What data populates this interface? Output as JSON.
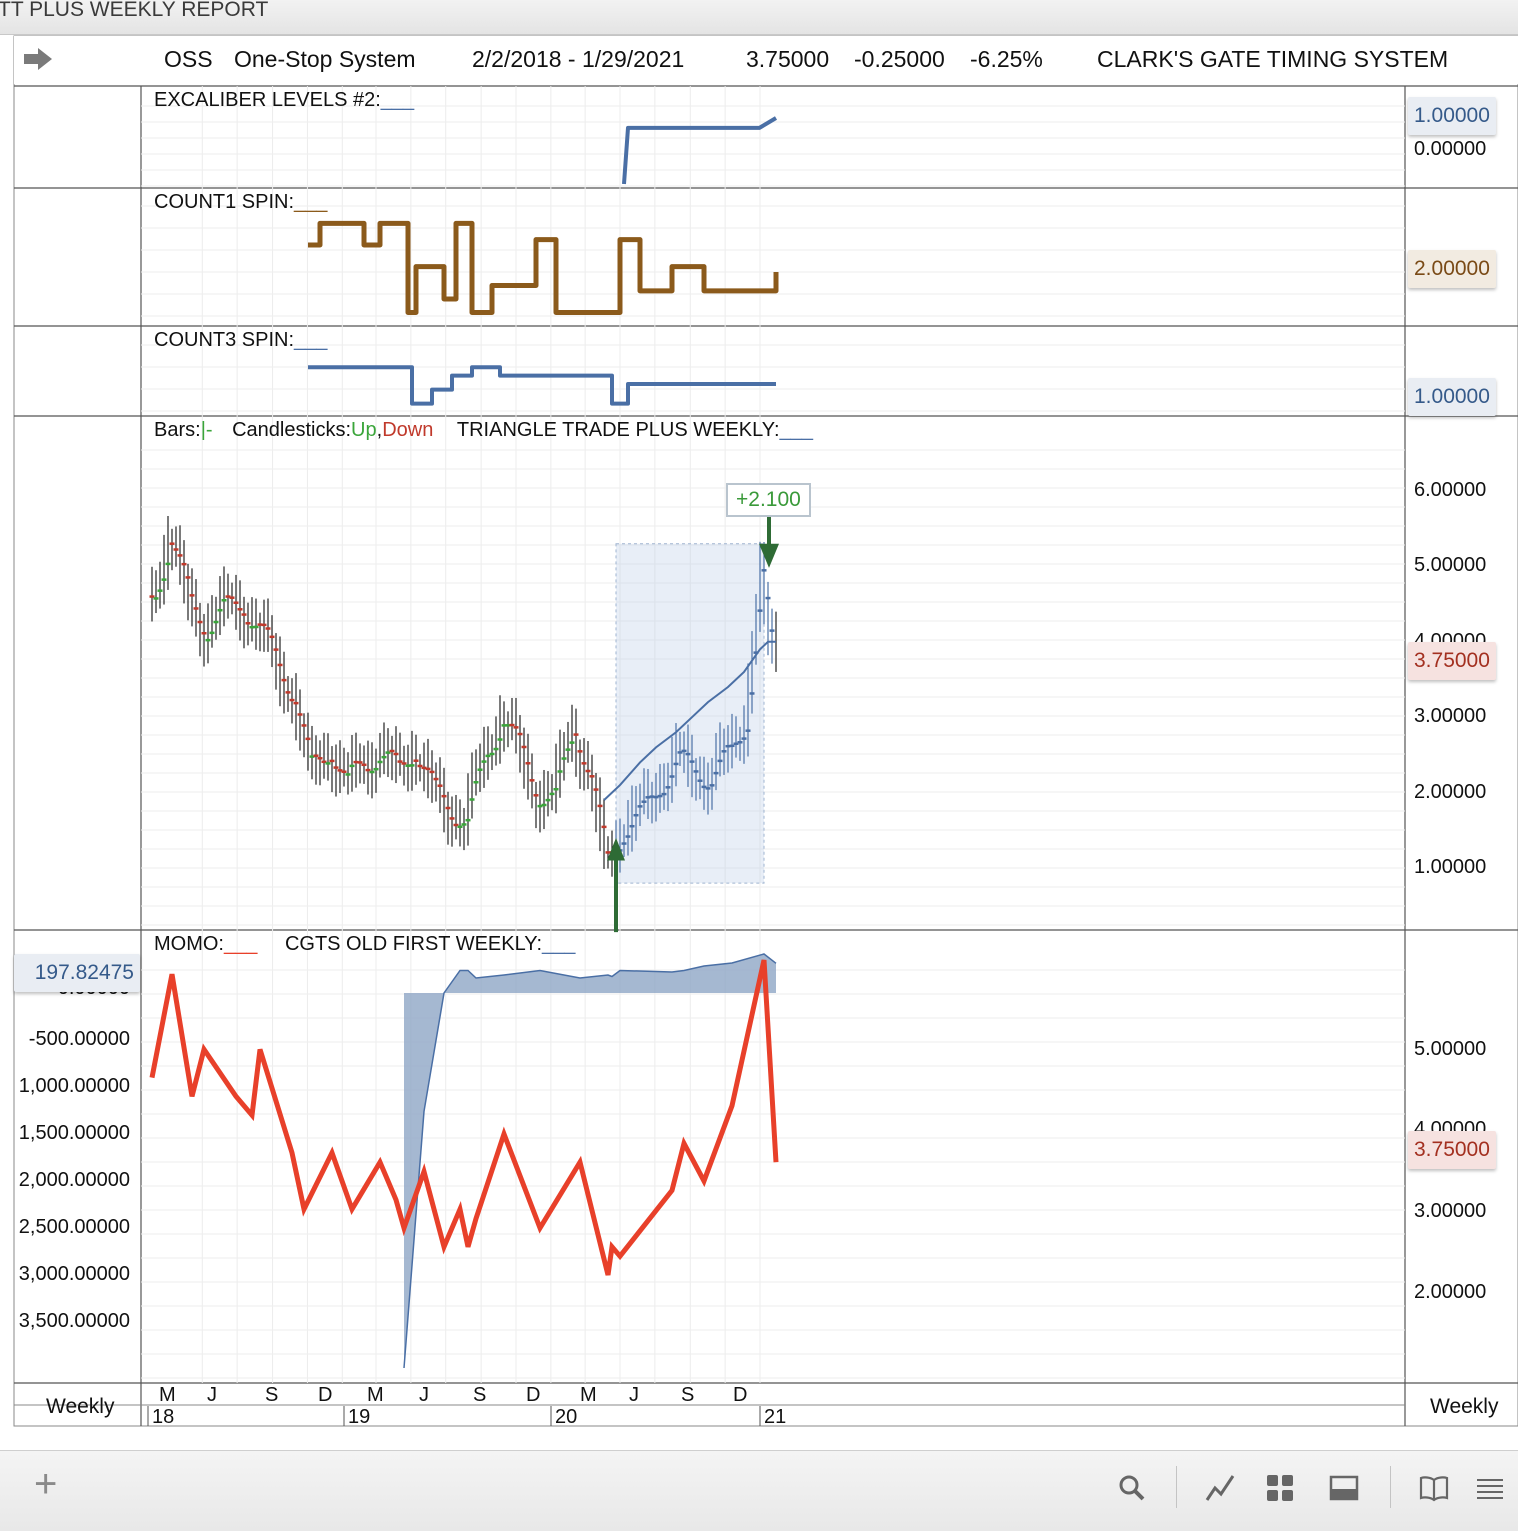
{
  "window": {
    "title": "TT PLUS WEEKLY REPORT"
  },
  "header": {
    "symbol": "OSS",
    "company": "One-Stop System",
    "date_range": "2/2/2018 - 1/29/2021",
    "last": "3.75000",
    "change": "-0.25000",
    "change_pct": "-6.25%",
    "system_name": "CLARK'S GATE TIMING SYSTEM"
  },
  "panes": {
    "excaliber": {
      "label": "EXCALIBER LEVELS #2:",
      "legend_blank": "___",
      "value_badge": "1.00000",
      "tick": "0.00000",
      "color": "#4a6fa5"
    },
    "count1": {
      "label": "COUNT1 SPIN:",
      "legend_blank": "___",
      "value_badge": "2.00000",
      "color": "#8b5a1b"
    },
    "count3": {
      "label": "COUNT3 SPIN:",
      "legend_blank": "___",
      "value_badge": "1.00000",
      "color": "#4a6fa5"
    },
    "price": {
      "bars_label": "Bars:",
      "bars_glyph": "|-",
      "candles_label": "Candlesticks:",
      "up": "Up",
      "comma": ",",
      "down": "Down",
      "indicator": "TRIANGLE TRADE PLUS WEEKLY:",
      "legend_blank": "___",
      "ticks": [
        "6.00000",
        "5.00000",
        "4.00000",
        "3.00000",
        "2.00000",
        "1.00000"
      ],
      "last_badge": "3.75000",
      "trade_gain": "+2.100"
    },
    "momo": {
      "label": "MOMO:",
      "legend_blank": "___",
      "indicator": "CGTS OLD FIRST WEEKLY:",
      "legend_blank2": "___",
      "left_badge": "197.82475",
      "left_hidden_tick": "0.00000",
      "left_ticks": [
        "-500.00000",
        "1,000.00000",
        "1,500.00000",
        "2,000.00000",
        "2,500.00000",
        "3,000.00000",
        "3,500.00000"
      ],
      "right_ticks": [
        "5.00000",
        "4.00000",
        "3.00000",
        "2.00000"
      ],
      "right_badge": "3.75000"
    }
  },
  "x_axis": {
    "months": [
      "M",
      "J",
      "S",
      "D",
      "M",
      "J",
      "S",
      "D",
      "M",
      "J",
      "S",
      "D"
    ],
    "years": [
      "18",
      "19",
      "20",
      "21"
    ],
    "period_left": "Weekly",
    "period_right": "Weekly"
  },
  "toolbar": {
    "add": "+",
    "icons": [
      "search-icon",
      "chart-line-icon",
      "grid-icon",
      "panel-icon",
      "book-icon",
      "list-icon"
    ]
  },
  "colors": {
    "up": "#3aa53a",
    "down": "#c0392b",
    "steel": "#4a6fa5",
    "brown": "#8b5a1b",
    "momo": "#e8402a",
    "trade_box": "rgba(180,200,230,0.30)",
    "arrow": "#2e6b35"
  },
  "chart_data": [
    {
      "type": "line",
      "title": "EXCALIBER LEVELS #2:",
      "x": [
        "2020-05-08",
        "2020-05-15",
        "2020-12-31",
        "2021-01-29"
      ],
      "series": [
        {
          "values": [
            0,
            0.85,
            0.85,
            1.0
          ]
        }
      ],
      "ylim": [
        0,
        1
      ]
    },
    {
      "type": "line",
      "title": "COUNT1 SPIN:",
      "x": [
        "2018-11-02",
        "2018-11-23",
        "2019-02-08",
        "2019-03-08",
        "2019-04-26",
        "2019-05-10",
        "2019-06-28",
        "2019-07-19",
        "2019-08-16",
        "2019-09-20",
        "2019-12-06",
        "2020-01-10",
        "2020-05-01",
        "2020-06-05",
        "2020-07-31",
        "2020-09-25",
        "2021-01-08",
        "2021-01-29"
      ],
      "series": [
        {
          "values": [
            3,
            3.8,
            3,
            3.8,
            0.5,
            2.2,
            1,
            3.8,
            0.5,
            1.5,
            3.2,
            0.5,
            3.2,
            1.3,
            2.2,
            1.3,
            1.3,
            2.0
          ]
        }
      ],
      "ylim": [
        0,
        4
      ]
    },
    {
      "type": "line",
      "title": "COUNT3 SPIN:",
      "x": [
        "2018-11-02",
        "2019-04-19",
        "2019-05-03",
        "2019-06-07",
        "2019-07-12",
        "2019-08-16",
        "2019-10-04",
        "2020-03-06",
        "2020-04-17",
        "2020-05-15",
        "2021-01-29"
      ],
      "series": [
        {
          "values": [
            1.6,
            1.6,
            0.3,
            0.8,
            1.3,
            1.6,
            1.3,
            1.3,
            0.3,
            1.0,
            1.0
          ]
        }
      ],
      "ylim": [
        0,
        2
      ]
    },
    {
      "type": "line",
      "title": "TRIANGLE TRADE PLUS WEEKLY:",
      "x": [
        "2018-02-02",
        "2018-03-02",
        "2018-04-06",
        "2018-05-04",
        "2018-06-01",
        "2018-07-06",
        "2018-08-03",
        "2018-09-07",
        "2018-10-05",
        "2018-11-02",
        "2018-12-07",
        "2019-01-04",
        "2019-02-01",
        "2019-03-01",
        "2019-04-05",
        "2019-05-03",
        "2019-06-07",
        "2019-07-05",
        "2019-08-02",
        "2019-09-06",
        "2019-10-04",
        "2019-11-01",
        "2019-12-06",
        "2020-01-03",
        "2020-02-07",
        "2020-03-06",
        "2020-04-03",
        "2020-05-01",
        "2020-06-05",
        "2020-07-03",
        "2020-08-07",
        "2020-09-04",
        "2020-10-02",
        "2020-11-06",
        "2020-12-04",
        "2021-01-01",
        "2021-01-15",
        "2021-01-29"
      ],
      "series": [
        {
          "name": "Up",
          "values": [
            4.6,
            5.4,
            4.5,
            4.2,
            4.4,
            4.5,
            4.2,
            3.7,
            3.3,
            2.3,
            2.6,
            2.1,
            2.4,
            2.5,
            2.3,
            2.6,
            2.0,
            1.8,
            1.6,
            2.5,
            3.0,
            2.6,
            2.0,
            1.9,
            2.9,
            2.2,
            1.1,
            1.5,
            1.7,
            2.1,
            2.4,
            2.3,
            2.2,
            2.5,
            3.0,
            4.8,
            4.0,
            3.75
          ]
        },
        {
          "name": "TRIANGLE TRADE PLUS WEEKLY",
          "values": [
            null,
            null,
            null,
            null,
            null,
            null,
            null,
            null,
            null,
            null,
            null,
            null,
            null,
            null,
            null,
            null,
            null,
            null,
            null,
            null,
            null,
            null,
            null,
            null,
            null,
            null,
            1.9,
            2.1,
            2.4,
            2.6,
            2.8,
            3.0,
            3.2,
            3.4,
            3.6,
            3.9,
            4.0,
            4.0
          ]
        }
      ],
      "trade": {
        "entry": 1.4,
        "exit": 5.3,
        "gain": "+2.100"
      },
      "ylim": [
        0,
        7
      ]
    },
    {
      "type": "line",
      "title": "MOMO:",
      "x": [
        "2018-02-02",
        "2018-03-09",
        "2018-04-13",
        "2018-05-04",
        "2018-06-29",
        "2018-07-27",
        "2018-08-10",
        "2018-10-05",
        "2018-10-26",
        "2018-12-14",
        "2019-01-18",
        "2019-03-08",
        "2019-04-05",
        "2019-04-19",
        "2019-05-24",
        "2019-06-28",
        "2019-07-26",
        "2019-08-09",
        "2019-08-23",
        "2019-10-11",
        "2019-12-13",
        "2020-02-21",
        "2020-04-10",
        "2020-04-17",
        "2020-05-01",
        "2020-07-31",
        "2020-08-21",
        "2020-09-25",
        "2020-11-13",
        "2021-01-08",
        "2021-01-29"
      ],
      "series": [
        {
          "name": "MOMO",
          "values": [
            -900,
            200,
            -1100,
            -600,
            -1100,
            -1300,
            -600,
            -1700,
            -2300,
            -1700,
            -2300,
            -1800,
            -2200,
            -2500,
            -1900,
            -2700,
            -2300,
            -2700,
            -2400,
            -1500,
            -2500,
            -1800,
            -3000,
            -2700,
            -2800,
            -2100,
            -1600,
            -2000,
            -1200,
            600,
            -1800
          ]
        },
        {
          "name": "CGTS OLD FIRST WEEKLY",
          "values": [
            null,
            null,
            null,
            null,
            null,
            null,
            null,
            null,
            null,
            null,
            null,
            null,
            null,
            -3800,
            -1200,
            0,
            150,
            150,
            100,
            120,
            150,
            100,
            120,
            110,
            150,
            140,
            150,
            180,
            200,
            260,
            197.82475
          ]
        }
      ],
      "ylim": [
        -4000,
        400
      ]
    }
  ]
}
